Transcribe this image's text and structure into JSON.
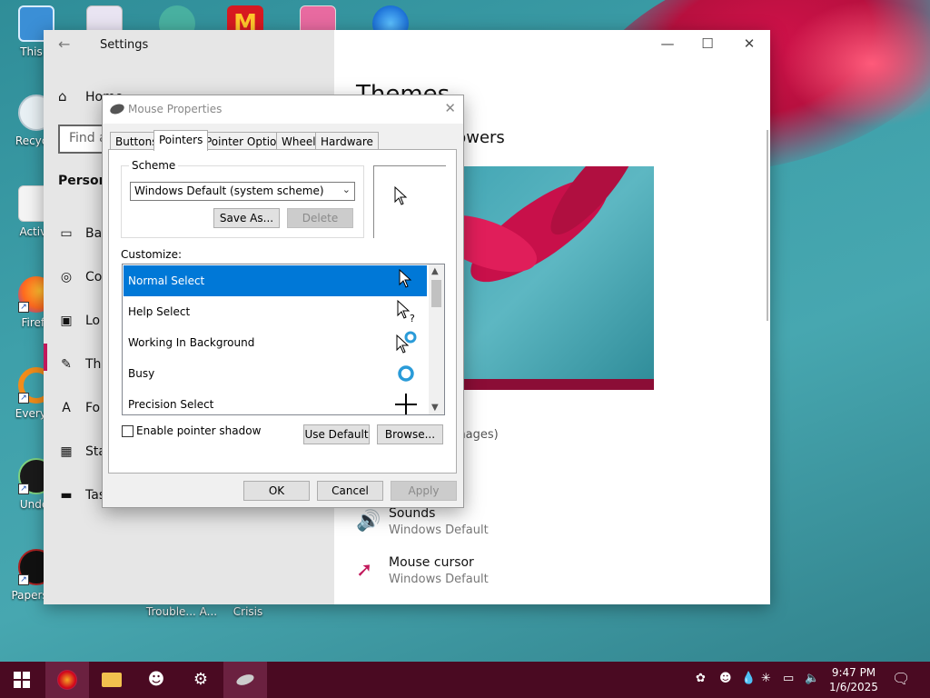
{
  "desktop": {
    "icons": [
      {
        "label": "This P"
      },
      {
        "label": "Recycle"
      },
      {
        "label": "Activa"
      },
      {
        "label": "Firefo"
      },
      {
        "label": "Everyth"
      },
      {
        "label": "Under"
      },
      {
        "label": "Papers, P"
      }
    ],
    "bottom_labels": [
      "Trouble... A...",
      "Crisis"
    ]
  },
  "settings": {
    "title": "Settings",
    "home": "Home",
    "find_placeholder": "Find a",
    "section": "Persona",
    "nav": [
      {
        "label": "Ba",
        "icon": "image-icon"
      },
      {
        "label": "Co",
        "icon": "palette-icon"
      },
      {
        "label": "Lo",
        "icon": "lock-screen-icon"
      },
      {
        "label": "The",
        "icon": "brush-icon"
      },
      {
        "label": "Fo",
        "icon": "font-icon"
      },
      {
        "label": "Sta",
        "icon": "start-icon"
      },
      {
        "label": "Tas",
        "icon": "taskbar-icon"
      }
    ],
    "page_title": "Themes",
    "current_theme": "e: Flowers",
    "images_label": "mages)",
    "sounds": {
      "name": "Sounds",
      "value": "Windows Default"
    },
    "mouse_cursor": {
      "name": "Mouse cursor",
      "value": "Windows Default"
    }
  },
  "mouse_props": {
    "title": "Mouse Properties",
    "tabs": [
      "Buttons",
      "Pointers",
      "Pointer Options",
      "Wheel",
      "Hardware"
    ],
    "active_tab": "Pointers",
    "scheme_label": "Scheme",
    "scheme_value": "Windows Default (system scheme)",
    "save_as": "Save As...",
    "delete": "Delete",
    "customize_label": "Customize:",
    "cursors": [
      {
        "name": "Normal Select",
        "icon": "arrow-cursor-icon",
        "selected": true
      },
      {
        "name": "Help Select",
        "icon": "help-cursor-icon",
        "selected": false
      },
      {
        "name": "Working In Background",
        "icon": "working-cursor-icon",
        "selected": false
      },
      {
        "name": "Busy",
        "icon": "busy-cursor-icon",
        "selected": false
      },
      {
        "name": "Precision Select",
        "icon": "crosshair-cursor-icon",
        "selected": false
      }
    ],
    "shadow_label": "Enable pointer shadow",
    "shadow_checked": false,
    "use_default": "Use Default",
    "browse": "Browse...",
    "ok": "OK",
    "cancel": "Cancel",
    "apply": "Apply"
  },
  "taskbar": {
    "time": "9:47 PM",
    "date": "1/6/2025"
  },
  "colors": {
    "taskbar": "#4a0a22",
    "accent": "#c2185b",
    "selection": "#0078d7"
  }
}
